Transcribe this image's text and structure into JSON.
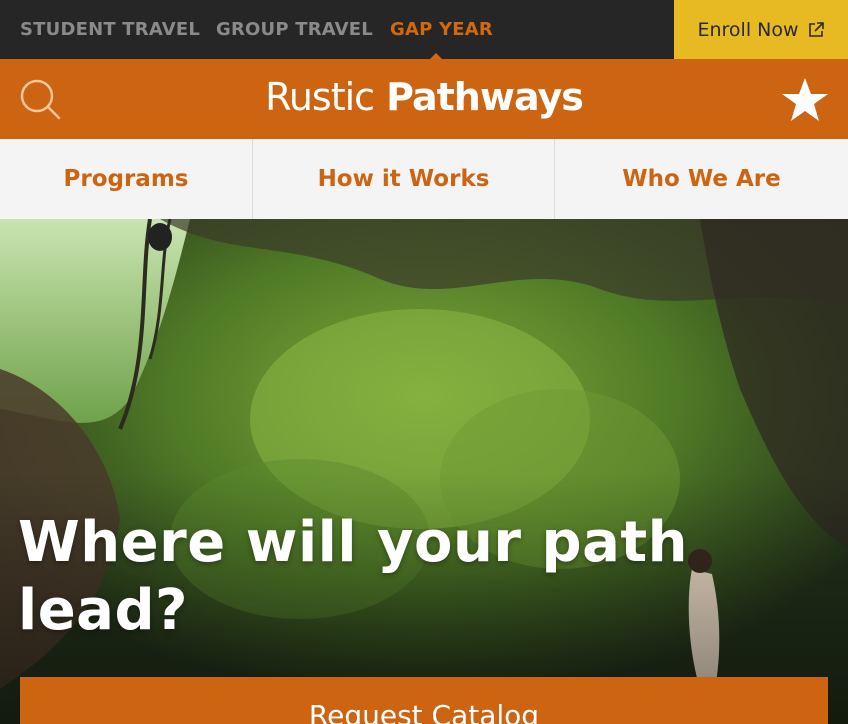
{
  "top_nav": {
    "tabs": [
      {
        "label": "STUDENT TRAVEL"
      },
      {
        "label": "GROUP TRAVEL"
      },
      {
        "label": "GAP YEAR"
      }
    ],
    "active_tab": "GAP YEAR",
    "enroll_label": "Enroll Now",
    "enroll_icon": "external-link-icon"
  },
  "header": {
    "logo_light": "Rustic",
    "logo_bold": "Pathways",
    "search_icon": "search-icon",
    "favorites_icon": "star-icon"
  },
  "sub_nav": {
    "items": [
      {
        "label": "Programs"
      },
      {
        "label": "How it Works"
      },
      {
        "label": "Who We Are"
      }
    ]
  },
  "hero": {
    "headline_line1": "Where will your path",
    "headline_line2": "lead?",
    "cta_label": "Request Catalog"
  },
  "colors": {
    "brand_orange": "#cd6412",
    "active_tab": "#d4680d",
    "enroll_yellow": "#e7b923",
    "topbar_bg": "#262626"
  }
}
